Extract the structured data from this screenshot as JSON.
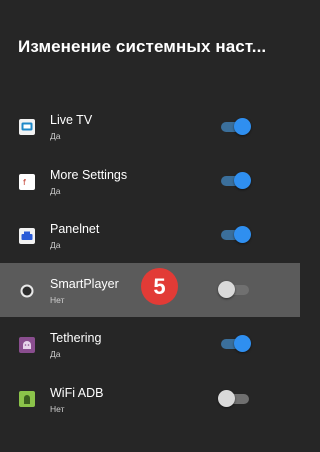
{
  "header": {
    "title": "Изменение системных наст..."
  },
  "items": [
    {
      "name": "",
      "status": "Да",
      "enabled": true,
      "icon": "green-app-icon",
      "icon_color": "#2e7d4f"
    },
    {
      "name": "Live TV",
      "status": "Да",
      "enabled": true,
      "icon": "live-tv-icon",
      "icon_color": "#1e88c8"
    },
    {
      "name": "More Settings",
      "status": "Да",
      "enabled": true,
      "icon": "more-settings-icon",
      "icon_color": "#ffffff"
    },
    {
      "name": "Panelnet",
      "status": "Да",
      "enabled": true,
      "icon": "panelnet-icon",
      "icon_color": "#2a5bd7"
    },
    {
      "name": "SmartPlayer",
      "status": "Нет",
      "enabled": false,
      "icon": "smartplayer-icon",
      "icon_color": "#e8e8e8",
      "selected": true
    },
    {
      "name": "Tethering",
      "status": "Да",
      "enabled": true,
      "icon": "android-icon",
      "icon_color": "#8a4e8f"
    },
    {
      "name": "WiFi ADB",
      "status": "Нет",
      "enabled": false,
      "icon": "wifi-adb-icon",
      "icon_color": "#8bc34a"
    }
  ],
  "badge": {
    "text": "5",
    "color": "#e23b36"
  },
  "colors": {
    "background": "#262626",
    "selected_row": "#5b5b5b",
    "toggle_on": "#2f8ff0",
    "toggle_off": "#d9d9d9"
  }
}
